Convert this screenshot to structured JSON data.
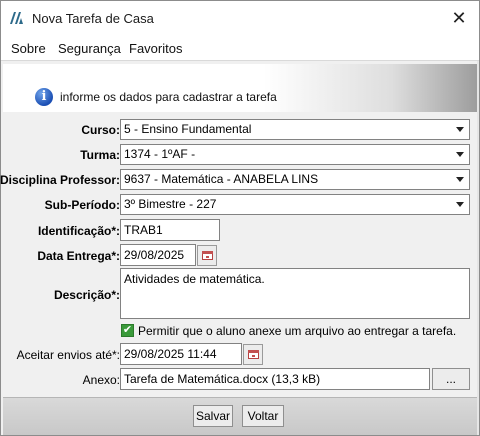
{
  "window": {
    "title": "Nova Tarefa de Casa",
    "close_glyph": "✕"
  },
  "menu": {
    "items": [
      {
        "label": "Sobre"
      },
      {
        "label": "Segurança"
      },
      {
        "label": "Favoritos"
      }
    ]
  },
  "banner": {
    "icon": "info-icon",
    "icon_glyph": "i",
    "text": "informe os dados para cadastrar a tarefa"
  },
  "form": {
    "curso": {
      "label": "Curso:",
      "value": "5 - Ensino Fundamental"
    },
    "turma": {
      "label": "Turma:",
      "value": "1374 - 1ºAF  -"
    },
    "disciplina": {
      "label": "Disciplina Professor:",
      "value": "9637 - Matemática  - ANABELA LINS"
    },
    "subperiodo": {
      "label": "Sub-Período:",
      "value": "3º Bimestre - 227"
    },
    "identificacao": {
      "label": "Identificação*:",
      "value": "TRAB1"
    },
    "data_entrega": {
      "label": "Data Entrega*:",
      "value": "29/08/2025"
    },
    "descricao": {
      "label": "Descrição*:",
      "value": "Atividades de matemática."
    },
    "permitir_anexo": {
      "label": "Permitir que o aluno anexe um arquivo ao entregar a tarefa.",
      "checked": true,
      "check_glyph": "✔"
    },
    "aceitar_envios": {
      "label": "Aceitar envios até*:",
      "value": "29/08/2025 11:44"
    },
    "anexo": {
      "label": "Anexo:",
      "value": "Tarefa de Matemática.docx (13,3 kB)",
      "browse_label": "..."
    }
  },
  "footer": {
    "salvar_label": "Salvar",
    "voltar_label": "Voltar"
  },
  "colors": {
    "checkbox": "#3a9a3a",
    "info_icon": "#1b4fb4",
    "calendar_icon": "#c35050"
  }
}
